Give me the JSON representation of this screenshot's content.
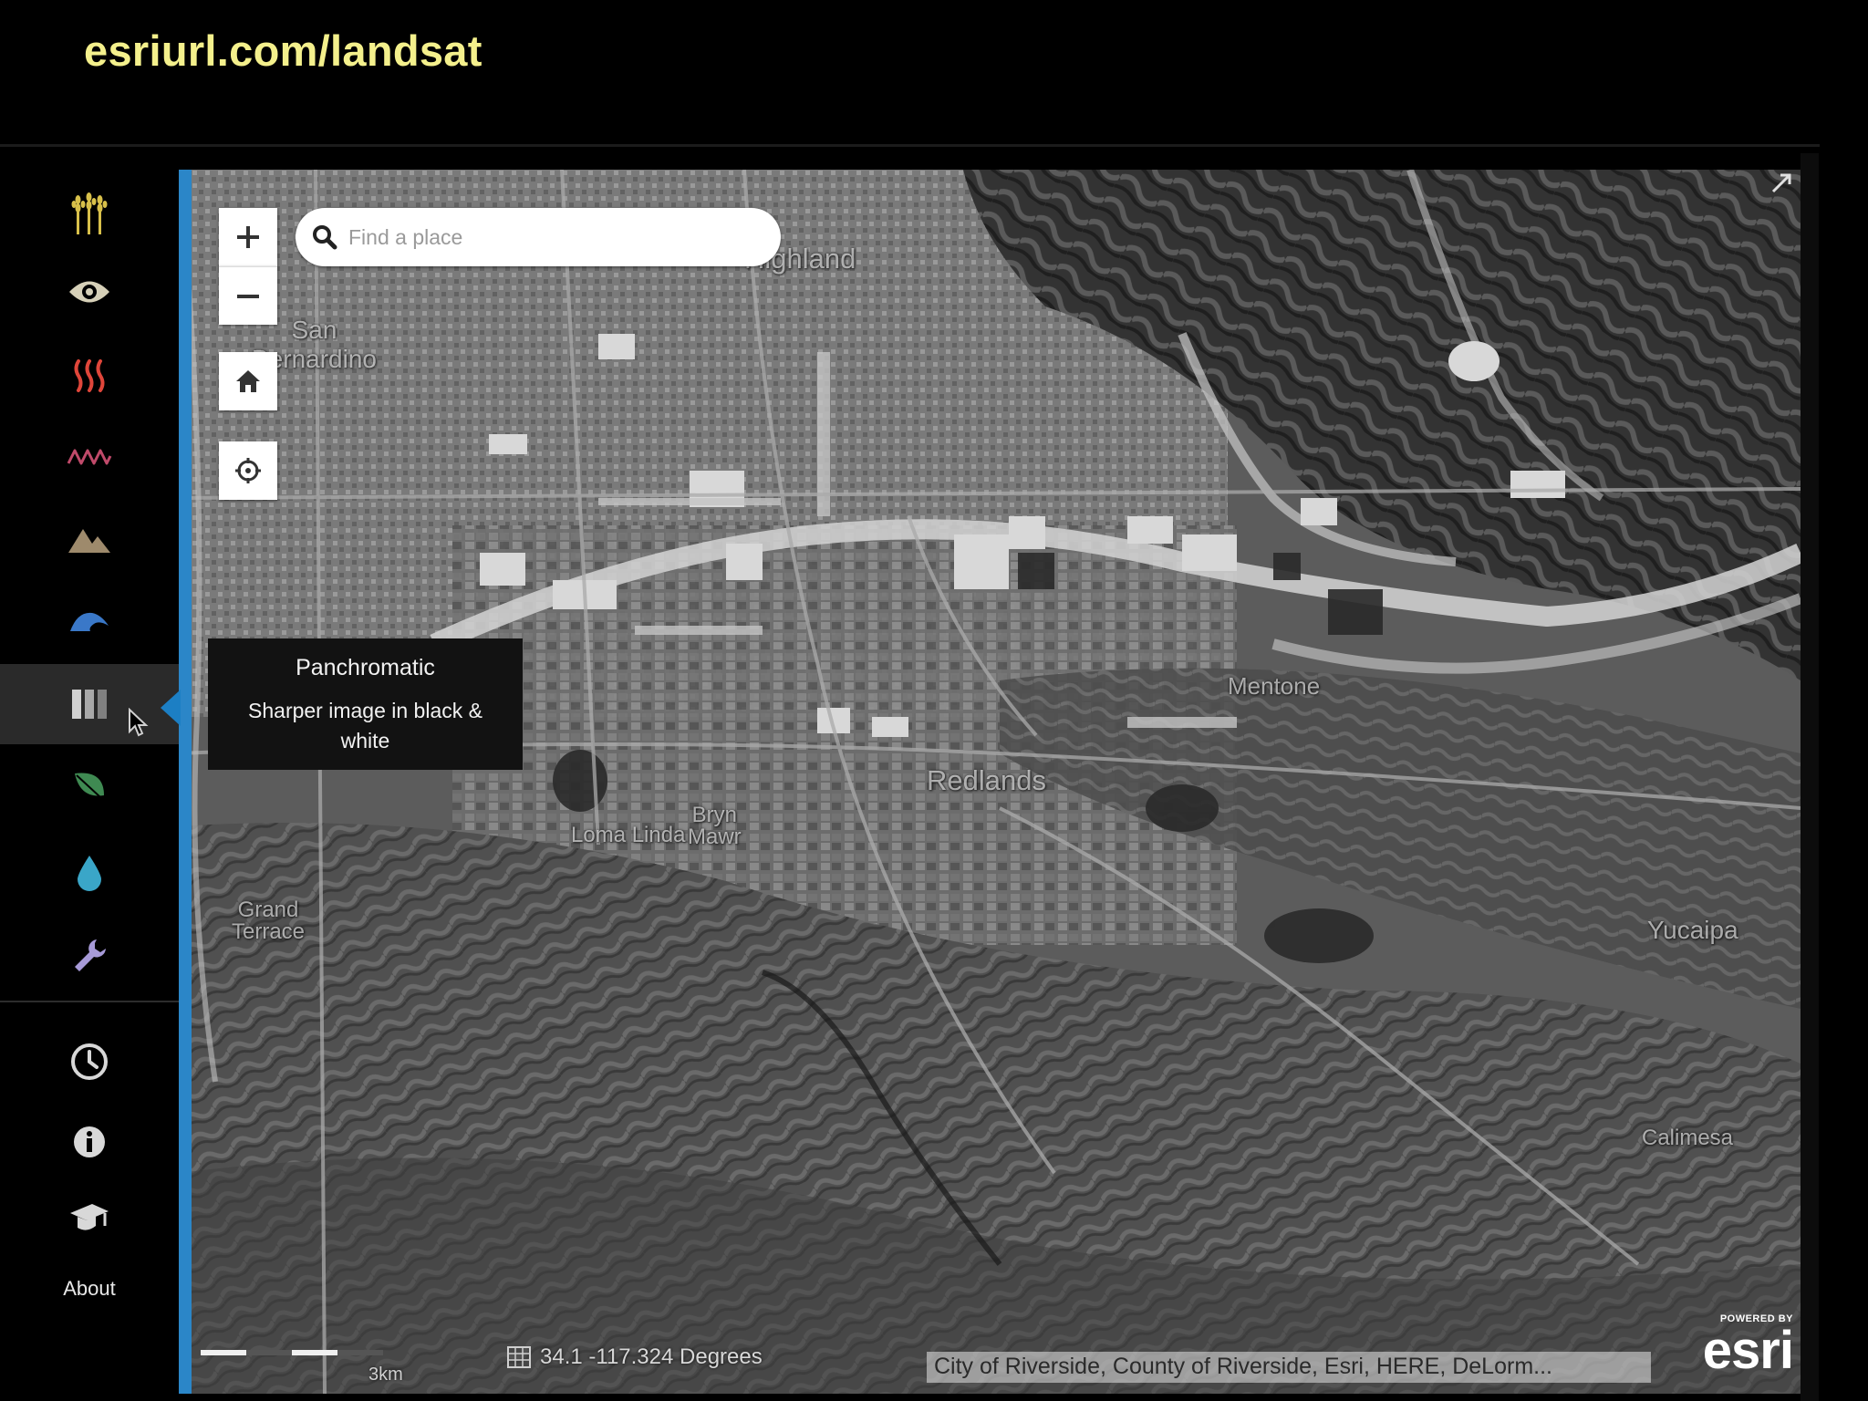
{
  "banner": {
    "url": "esriurl.com/landsat"
  },
  "sidebar": {
    "items": [
      {
        "name": "agriculture",
        "icon": "wheat-icon",
        "color": "#d8c04a"
      },
      {
        "name": "natural-color",
        "icon": "eye-icon",
        "color": "#d6d0b8"
      },
      {
        "name": "thermal",
        "icon": "heat-waves-icon",
        "color": "#e0463a"
      },
      {
        "name": "color-infrared",
        "icon": "zigzag-wave-icon",
        "color": "#c04a6a"
      },
      {
        "name": "geology",
        "icon": "mountains-icon",
        "color": "#9e8a6c"
      },
      {
        "name": "bathymetric",
        "icon": "wave-icon",
        "color": "#3a78c8"
      },
      {
        "name": "panchromatic",
        "icon": "bars-icon",
        "color": "#d0d0d0",
        "active": true
      },
      {
        "name": "vegetation-index",
        "icon": "leaf-icon",
        "color": "#3f8a52"
      },
      {
        "name": "moisture-index",
        "icon": "water-drop-icon",
        "color": "#3aa6c8"
      },
      {
        "name": "custom",
        "icon": "wrench-icon",
        "color": "#a79ad8"
      },
      {
        "name": "time",
        "icon": "clock-icon",
        "color": "#d8d8d8"
      },
      {
        "name": "info",
        "icon": "info-icon",
        "color": "#d8d8d8"
      },
      {
        "name": "education",
        "icon": "graduation-cap-icon",
        "color": "#d8d8d8"
      }
    ],
    "about_label": "About"
  },
  "tooltip": {
    "title": "Panchromatic",
    "description": "Sharper image in black & white"
  },
  "search": {
    "placeholder": "Find a place"
  },
  "map": {
    "labels": [
      {
        "text": "Highland",
        "key": "highland"
      },
      {
        "text": "San\nBernardino",
        "key": "san-bernardino"
      },
      {
        "text": "Mentone",
        "key": "mentone"
      },
      {
        "text": "Redlands",
        "key": "redlands"
      },
      {
        "text": "Bryn\nMawr",
        "key": "bryn-mawr"
      },
      {
        "text": "Loma Linda",
        "key": "loma-linda"
      },
      {
        "text": "Grand\nTerrace",
        "key": "grand-terrace"
      },
      {
        "text": "Yucaipa",
        "key": "yucaipa"
      },
      {
        "text": "Calimesa",
        "key": "calimesa"
      }
    ],
    "scale_label": "3km",
    "coordinates": "34.1 -117.324 Degrees",
    "attribution": "City of Riverside, County of Riverside, Esri, HERE, DeLorm...",
    "powered_by": "POWERED BY",
    "esri_logo": "esri"
  }
}
